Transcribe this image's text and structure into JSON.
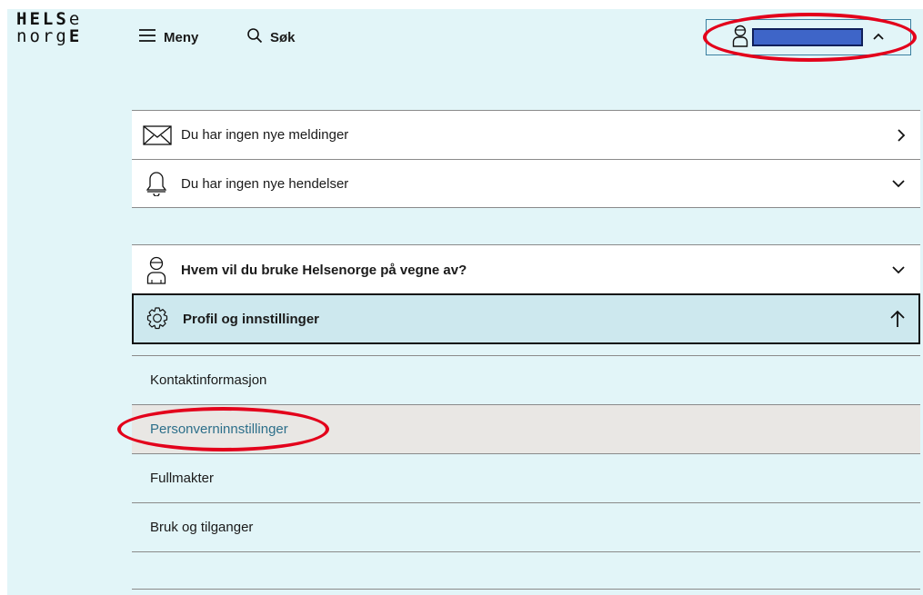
{
  "logo": {
    "line1": [
      "H",
      "E",
      "L",
      "S",
      "e"
    ],
    "line2": [
      "n",
      "o",
      "r",
      "g",
      "E"
    ]
  },
  "header": {
    "menu_label": "Meny",
    "search_label": "Søk"
  },
  "notifications": [
    {
      "label": "Du har ingen nye meldinger",
      "icon": "envelope-icon",
      "arrow": "chevron-right-icon"
    },
    {
      "label": "Du har ingen nye hendelser",
      "icon": "bell-icon",
      "arrow": "chevron-down-icon"
    }
  ],
  "profile_section": {
    "represent_label": "Hvem vil du bruke Helsenorge på vegne av?",
    "settings_label": "Profil og innstillinger",
    "submenu": [
      {
        "label": "Kontaktinformasjon",
        "active": false
      },
      {
        "label": "Personverninnstillinger",
        "active": true
      },
      {
        "label": "Fullmakter",
        "active": false
      },
      {
        "label": "Bruk og tilganger",
        "active": false
      }
    ]
  },
  "colors": {
    "panel_bg": "#e2f5f8",
    "settings_bg": "#cde8ee",
    "active_bg": "#e9e7e4",
    "active_text": "#2d6f8a",
    "highlight": "#e3001b",
    "redacted_name": "#3e65c8"
  }
}
